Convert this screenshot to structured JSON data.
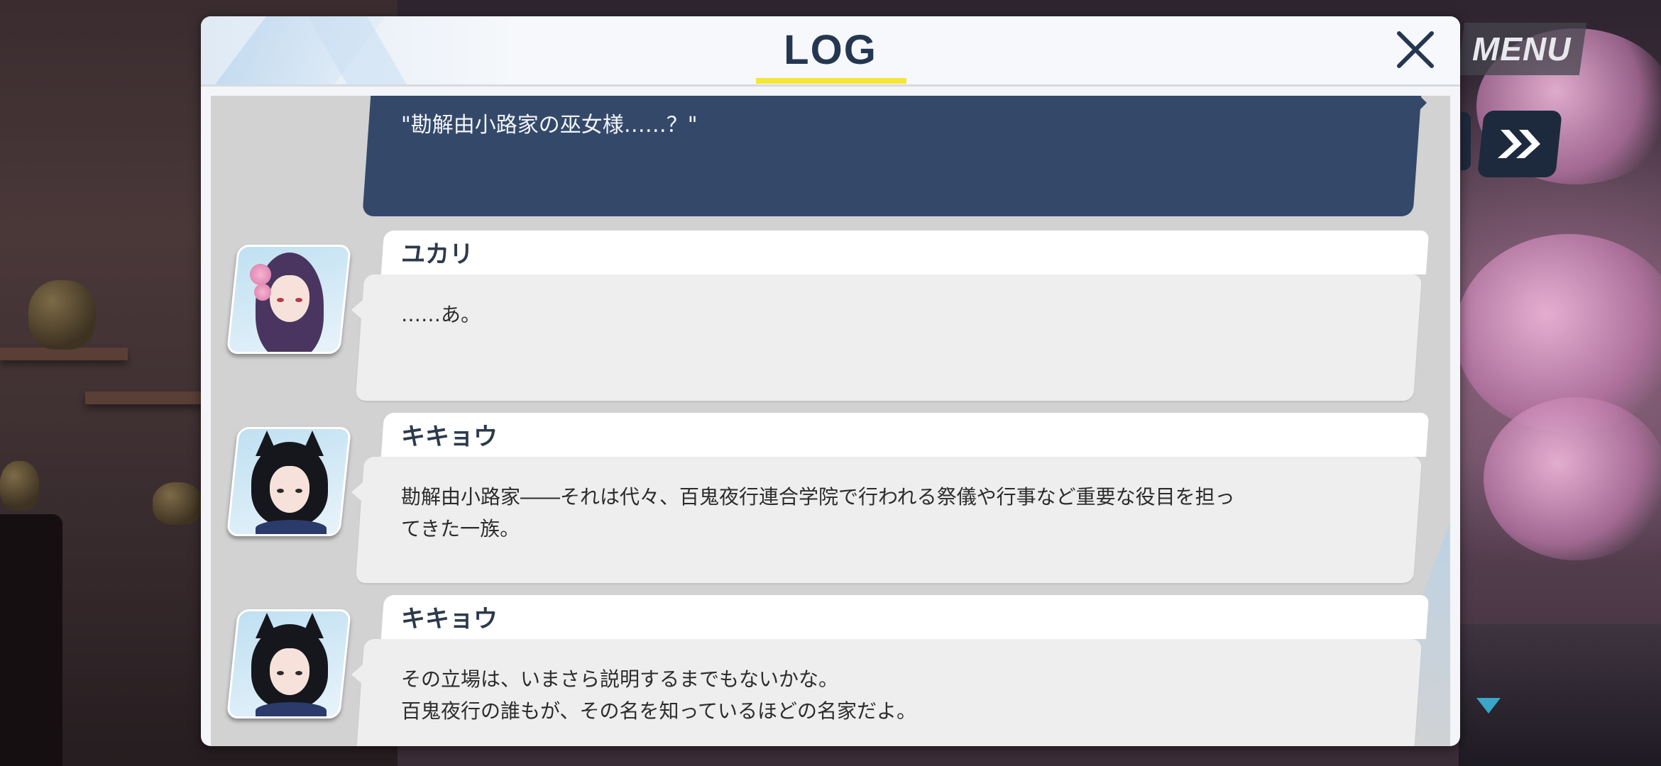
{
  "hud": {
    "menu_label": "MENU"
  },
  "log": {
    "title": "LOG",
    "entries": [
      {
        "speaker": "",
        "text": "\"勘解由小路家の巫女様……？\""
      },
      {
        "speaker": "ユカリ",
        "text": "……あ。"
      },
      {
        "speaker": "キキョウ",
        "text_lines": [
          "勘解由小路家――それは代々、百鬼夜行連合学院で行われる祭儀や行事など重要な役目を担っ",
          "てきた一族。"
        ]
      },
      {
        "speaker": "キキョウ",
        "text_lines": [
          "その立場は、いまさら説明するまでもないかな。",
          "百鬼夜行の誰もが、その名を知っているほどの名家だよ。"
        ]
      }
    ]
  },
  "colors": {
    "player_bubble": "#34496a",
    "title_underline": "#f5e538",
    "title_text": "#253750"
  },
  "icons": [
    "close-icon",
    "skip-forward-icon",
    "scroll-down-arrow-icon"
  ]
}
